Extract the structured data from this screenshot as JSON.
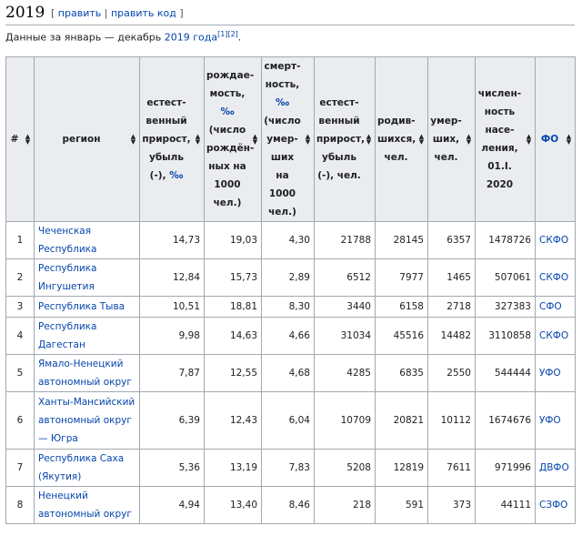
{
  "section": {
    "title": "2019",
    "edit_open": "[",
    "edit_label": "править",
    "edit_sep": "|",
    "edit_code_label": "править код",
    "edit_close": "]"
  },
  "intro": {
    "text": "Данные за январь — декабрь ",
    "link": "2019 года",
    "ref1": "[1]",
    "ref2": "[2]",
    "tail": "."
  },
  "table": {
    "headers": [
      {
        "key": "num",
        "label": "#"
      },
      {
        "key": "region",
        "label": "регион"
      },
      {
        "key": "natural",
        "label": "естест-венный прирост, убыль (-),",
        "unit": "‰"
      },
      {
        "key": "birth",
        "label": "рождае-мость,",
        "unit": "‰",
        "extra": "(число рождён-ных на 1000 чел.)"
      },
      {
        "key": "death",
        "label": "смерт-ность,",
        "unit": "‰",
        "extra": "(число умер-ших на 1000 чел.)"
      },
      {
        "key": "natural_abs",
        "label": "естест-венный прирост, убыль (-), чел."
      },
      {
        "key": "born",
        "label": "родив-шихся, чел."
      },
      {
        "key": "died",
        "label": "умер-ших, чел."
      },
      {
        "key": "population",
        "label": "числен-ность насе-ления, 01.I. 2020"
      },
      {
        "key": "fo",
        "label": "ФО"
      }
    ],
    "sort_icon": "▲\n▼",
    "rows": [
      {
        "num": "1",
        "region": "Чеченская Республика",
        "natural": "14,73",
        "birth": "19,03",
        "death": "4,30",
        "natural_abs": "21788",
        "born": "28145",
        "died": "6357",
        "population": "1478726",
        "fo": "СКФО"
      },
      {
        "num": "2",
        "region": "Республика Ингушетия",
        "natural": "12,84",
        "birth": "15,73",
        "death": "2,89",
        "natural_abs": "6512",
        "born": "7977",
        "died": "1465",
        "population": "507061",
        "fo": "СКФО"
      },
      {
        "num": "3",
        "region": "Республика Тыва",
        "natural": "10,51",
        "birth": "18,81",
        "death": "8,30",
        "natural_abs": "3440",
        "born": "6158",
        "died": "2718",
        "population": "327383",
        "fo": "СФО"
      },
      {
        "num": "4",
        "region": "Республика Дагестан",
        "natural": "9,98",
        "birth": "14,63",
        "death": "4,66",
        "natural_abs": "31034",
        "born": "45516",
        "died": "14482",
        "population": "3110858",
        "fo": "СКФО"
      },
      {
        "num": "5",
        "region": "Ямало-Ненецкий автономный округ",
        "natural": "7,87",
        "birth": "12,55",
        "death": "4,68",
        "natural_abs": "4285",
        "born": "6835",
        "died": "2550",
        "population": "544444",
        "fo": "УФО"
      },
      {
        "num": "6",
        "region": "Ханты-Мансийский автономный округ — Югра",
        "natural": "6,39",
        "birth": "12,43",
        "death": "6,04",
        "natural_abs": "10709",
        "born": "20821",
        "died": "10112",
        "population": "1674676",
        "fo": "УФО"
      },
      {
        "num": "7",
        "region": "Республика Саха (Якутия)",
        "natural": "5,36",
        "birth": "13,19",
        "death": "7,83",
        "natural_abs": "5208",
        "born": "12819",
        "died": "7611",
        "population": "971996",
        "fo": "ДВФО"
      },
      {
        "num": "8",
        "region": "Ненецкий автономный округ",
        "natural": "4,94",
        "birth": "13,40",
        "death": "8,46",
        "natural_abs": "218",
        "born": "591",
        "died": "373",
        "population": "44111",
        "fo": "СЗФО"
      }
    ]
  }
}
